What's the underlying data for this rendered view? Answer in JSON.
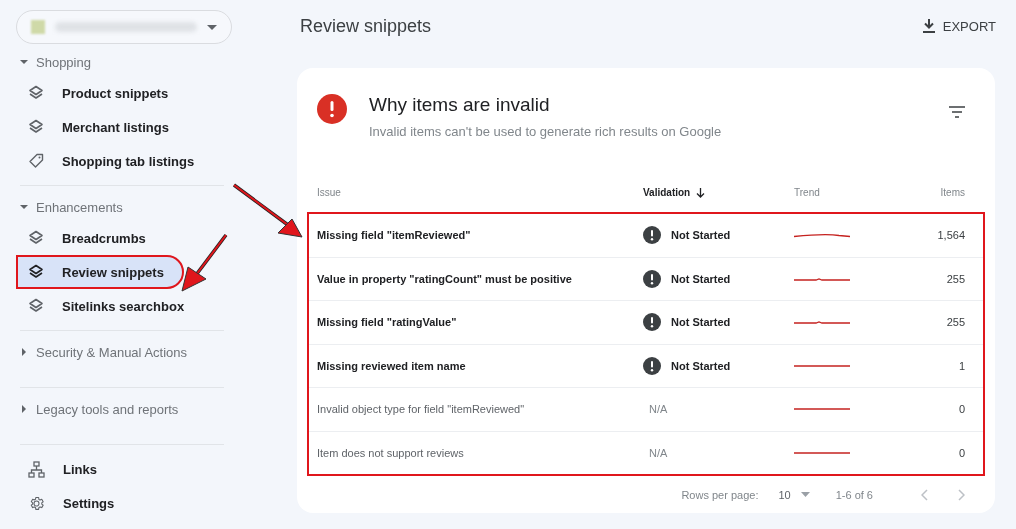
{
  "sidebar": {
    "sections": [
      {
        "title": "Shopping",
        "expanded": true,
        "items": [
          {
            "label": "Product snippets",
            "kind": "report",
            "selected": false
          },
          {
            "label": "Merchant listings",
            "kind": "report",
            "selected": false
          },
          {
            "label": "Shopping tab listings",
            "kind": "listing",
            "selected": false
          }
        ]
      },
      {
        "title": "Enhancements",
        "expanded": true,
        "items": [
          {
            "label": "Breadcrumbs",
            "kind": "report",
            "selected": false
          },
          {
            "label": "Review snippets",
            "kind": "report",
            "selected": true
          },
          {
            "label": "Sitelinks searchbox",
            "kind": "report",
            "selected": false
          }
        ]
      },
      {
        "title": "Security & Manual Actions",
        "expanded": false
      },
      {
        "title": "Legacy tools and reports",
        "expanded": false
      }
    ],
    "bottom_items": [
      {
        "label": "Links",
        "kind": "links",
        "selected": false
      },
      {
        "label": "Settings",
        "kind": "settings",
        "selected": false
      }
    ]
  },
  "header": {
    "title": "Review snippets",
    "export": "EXPORT"
  },
  "card": {
    "title": "Why items are invalid",
    "subtitle": "Invalid items can't be used to generate rich results on Google"
  },
  "table": {
    "columns": [
      {
        "label": "Issue",
        "sorted": false
      },
      {
        "label": "Validation",
        "sorted": true
      },
      {
        "label": "Trend",
        "sorted": false
      },
      {
        "label": "Items",
        "sorted": false
      }
    ],
    "rows": [
      {
        "issue": "Missing field \"itemReviewed\"",
        "validation": {
          "kind": "not_started",
          "label": "Not Started"
        },
        "items": "1,564"
      },
      {
        "issue": "Value in property \"ratingCount\" must be positive",
        "validation": {
          "kind": "not_started",
          "label": "Not Started"
        },
        "items": "255"
      },
      {
        "issue": "Missing field \"ratingValue\"",
        "validation": {
          "kind": "not_started",
          "label": "Not Started"
        },
        "items": "255"
      },
      {
        "issue": "Missing reviewed item name",
        "validation": {
          "kind": "not_started",
          "label": "Not Started"
        },
        "items": "1"
      },
      {
        "issue": "Invalid object type for field \"itemReviewed\"",
        "validation": {
          "kind": "na",
          "label": "N/A"
        },
        "items": "0"
      },
      {
        "issue": "Item does not support reviews",
        "validation": {
          "kind": "na",
          "label": "N/A"
        },
        "items": "0"
      }
    ]
  },
  "pagination": {
    "rows_per_page_label": "Rows per page:",
    "rows_per_page": "10",
    "range": "1-6 of 6"
  }
}
